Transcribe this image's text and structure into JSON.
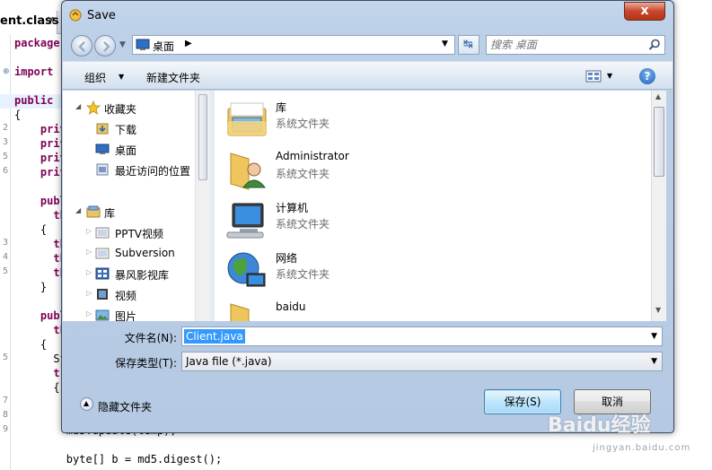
{
  "editor": {
    "tab_label": "ent.class",
    "tab_close": "×",
    "lines": [
      {
        "num": "",
        "code": "package",
        "kw": true
      },
      {
        "num": "",
        "code": "import ",
        "kw": true
      },
      {
        "num": "",
        "code": "public ",
        "kw": true
      },
      {
        "num": "",
        "code": "{",
        "kw": false
      },
      {
        "num": "2",
        "code": "    priva",
        "kw": true
      },
      {
        "num": "3",
        "code": "    priva",
        "kw": true
      },
      {
        "num": "5",
        "code": "    priva",
        "kw": true
      },
      {
        "num": "6",
        "code": "    priva",
        "kw": true
      },
      {
        "num": "",
        "code": "    publi",
        "kw": true
      },
      {
        "num": "",
        "code": "      thro",
        "kw": true
      },
      {
        "num": "",
        "code": "    {",
        "kw": false
      },
      {
        "num": "3",
        "code": "      thi",
        "kw": true
      },
      {
        "num": "4",
        "code": "      thi",
        "kw": true
      },
      {
        "num": "5",
        "code": "      thi",
        "kw": true
      },
      {
        "num": "",
        "code": "    }",
        "kw": false
      },
      {
        "num": "",
        "code": "    publi",
        "kw": true
      },
      {
        "num": "",
        "code": "      thro",
        "kw": true
      },
      {
        "num": "",
        "code": "    {",
        "kw": false
      },
      {
        "num": "5",
        "code": "      Str",
        "kw": false
      },
      {
        "num": "",
        "code": "      try",
        "kw": true
      },
      {
        "num": "",
        "code": "      {",
        "kw": false
      },
      {
        "num": "7",
        "code": "        by",
        "kw": true
      },
      {
        "num": "8",
        "code": "        Me",
        "kw": false
      },
      {
        "num": "9",
        "code": "        md5.update(temp);",
        "kw": false
      },
      {
        "num": "",
        "code": "",
        "kw": false
      },
      {
        "num": "",
        "code": "        byte[] b = md5.digest();",
        "kw": false
      }
    ]
  },
  "dialog": {
    "title": "Save",
    "close_glyph": "x",
    "address": {
      "location": "桌面",
      "separator": "▶"
    },
    "search": {
      "placeholder": "搜索 桌面"
    },
    "toolbar": {
      "organize": "组织",
      "new_folder": "新建文件夹",
      "help": "?"
    },
    "nav": {
      "favorites": "收藏夹",
      "downloads": "下载",
      "desktop": "桌面",
      "recent": "最近访问的位置",
      "libraries": "库",
      "pptv": "PPTV视频",
      "subversion": "Subversion",
      "baofeng": "暴风影视库",
      "video": "视频",
      "pictures": "图片"
    },
    "files": [
      {
        "name": "库",
        "type": "系统文件夹"
      },
      {
        "name": "Administrator",
        "type": "系统文件夹"
      },
      {
        "name": "计算机",
        "type": "系统文件夹"
      },
      {
        "name": "网络",
        "type": "系统文件夹"
      },
      {
        "name": "baidu",
        "type": ""
      }
    ],
    "form": {
      "filename_label": "文件名(N):",
      "filename_value": "Client.java",
      "filetype_label": "保存类型(T):",
      "filetype_value": "Java file (*.java)"
    },
    "hide_folders": "隐藏文件夹",
    "save_button": "保存(S)",
    "cancel_button": "取消"
  },
  "watermark": {
    "text": "Baidu经验",
    "sub": "jingyan.baidu.com"
  },
  "colors": {
    "accent": "#3399ff",
    "titlebar": "#bcd0e8",
    "close": "#c9462c"
  }
}
